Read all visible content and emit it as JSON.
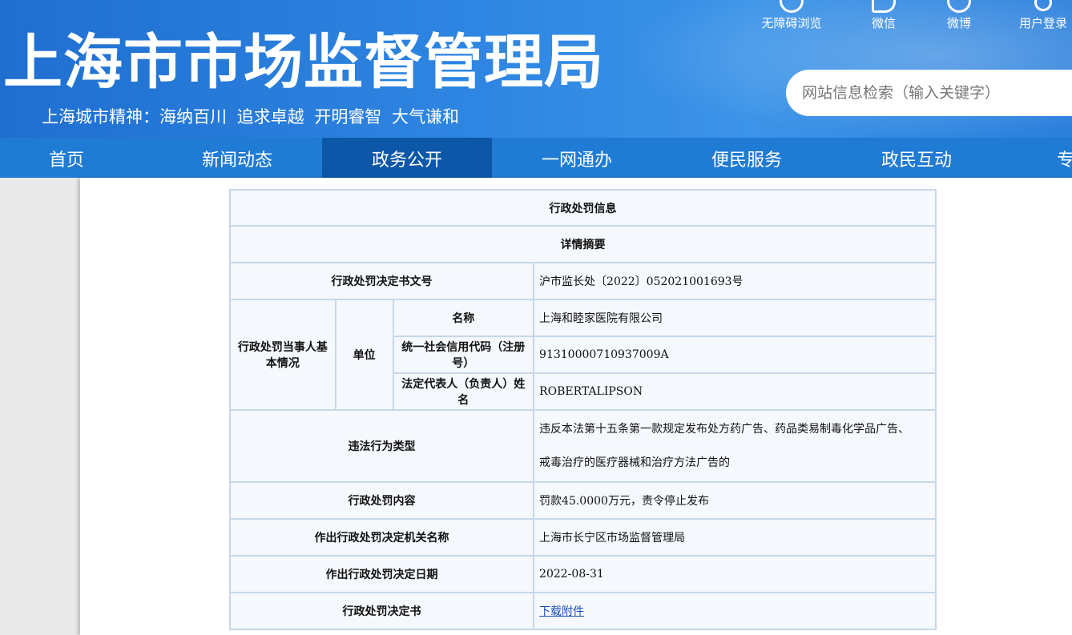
{
  "header": {
    "site_title": "上海市市场监督管理局",
    "slogan": "上海城市精神：海纳百川  追求卓越  开明睿智  大气谦和",
    "tools": [
      {
        "label": "无障碍浏览",
        "icon": "accessibility-icon"
      },
      {
        "label": "微信",
        "icon": "wechat-icon"
      },
      {
        "label": "微博",
        "icon": "weibo-icon"
      },
      {
        "label": "用户登录",
        "icon": "user-icon"
      }
    ],
    "search_placeholder": "网站信息检索（输入关键字）"
  },
  "nav": {
    "items": [
      "首页",
      "新闻动态",
      "政务公开",
      "一网通办",
      "便民服务",
      "政民互动",
      "专"
    ],
    "active": "政务公开"
  },
  "table": {
    "title": "行政处罚信息",
    "subtitle": "详情摘要",
    "doc_no_label": "行政处罚决定书文号",
    "doc_no_value": "沪市监长处〔2022〕052021001693号",
    "party_label": "行政处罚当事人基本情况",
    "unit_label": "单位",
    "name_label": "名称",
    "name_value": "上海和睦家医院有限公司",
    "credit_code_label": "统一社会信用代码（注册号）",
    "credit_code_value": "91310000710937009A",
    "legal_rep_label": "法定代表人（负责人）姓名",
    "legal_rep_value": "ROBERTALIPSON",
    "violation_label": "违法行为类型",
    "violation_value_line1": "违反本法第十五条第一款规定发布处方药广告、药品类易制毒化学品广告、",
    "violation_value_line2": "戒毒治疗的医疗器械和治疗方法广告的",
    "penalty_label": "行政处罚内容",
    "penalty_value": "罚款45.0000万元，责令停止发布",
    "authority_label": "作出行政处罚决定机关名称",
    "authority_value": "上海市长宁区市场监督管理局",
    "date_label": "作出行政处罚决定日期",
    "date_value": "2022-08-31",
    "decision_label": "行政处罚决定书",
    "decision_link": "下载附件"
  }
}
